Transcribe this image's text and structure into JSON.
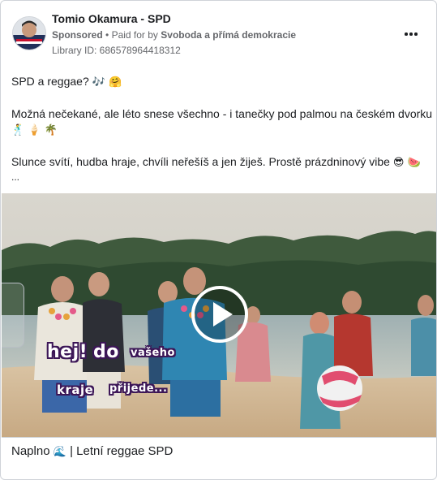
{
  "header": {
    "page_name": "Tomio Okamura - SPD",
    "sponsored_label": "Sponsored",
    "separator": "•",
    "paid_for_prefix": "Paid for by",
    "payer": "Svoboda a přímá demokracie",
    "library_id": "Library ID: 686578964418312"
  },
  "post": {
    "line1": "SPD a reggae?",
    "line1_emoji": "🎶 🤗",
    "line2": "Možná nečekané, ale léto snese všechno - i tanečky pod palmou na českém dvorku",
    "line2_emoji": "🕺 🍦 🌴",
    "line3": "Slunce svítí, hudba hraje, chvíli neřešíš a jen žiješ. Prostě prázdninový vibe",
    "line3_emoji": "😎 🍉",
    "ellipsis": "..."
  },
  "video": {
    "overlay_text": [
      "hej!",
      "do",
      "vašeho",
      "kraje",
      "přijede..."
    ]
  },
  "caption": {
    "text": "Naplno",
    "emoji": "🌊",
    "rest": "| Letní reggae SPD"
  },
  "colors": {
    "text_primary": "#1c1e21",
    "text_secondary": "#65676b",
    "border": "#cfd3d8",
    "overlay_outline": "#3c1657"
  },
  "icons": {
    "more": "more-options-icon",
    "play": "play-icon"
  }
}
